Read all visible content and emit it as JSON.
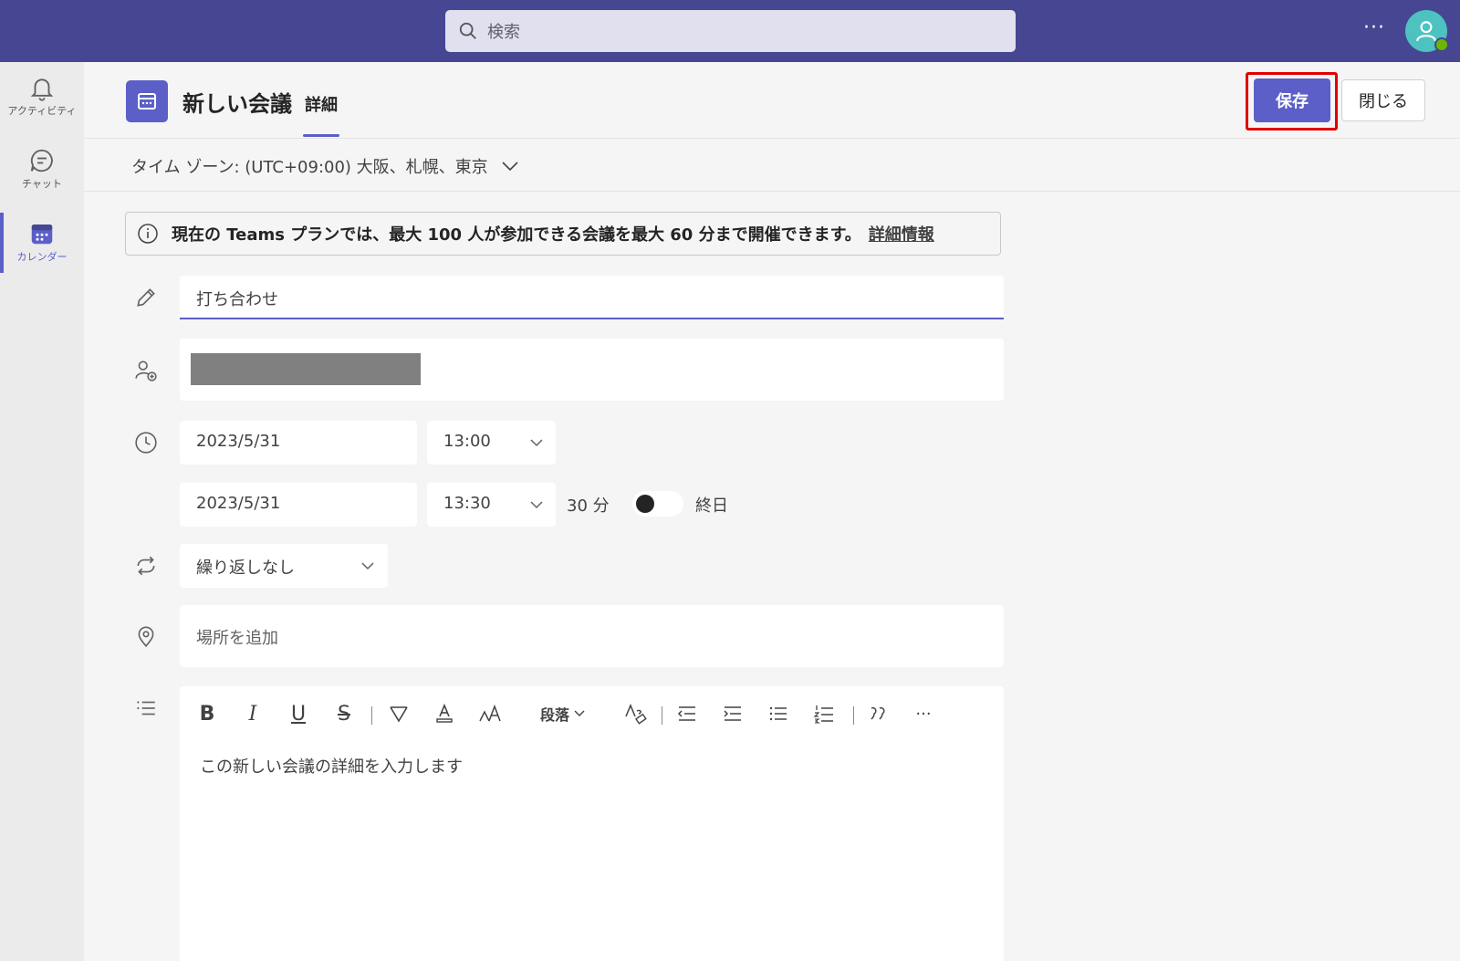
{
  "topbar": {
    "search_placeholder": "検索",
    "more": "···"
  },
  "rail": {
    "items": [
      {
        "label": "アクティビティ",
        "icon": "bell-icon"
      },
      {
        "label": "チャット",
        "icon": "chat-icon"
      },
      {
        "label": "カレンダー",
        "icon": "calendar-icon"
      }
    ]
  },
  "header": {
    "title": "新しい会議",
    "tab": "詳細",
    "save_label": "保存",
    "close_label": "閉じる"
  },
  "timezone": {
    "label": "タイム ゾーン: (UTC+09:00) 大阪、札幌、東京"
  },
  "banner": {
    "text": "現在の Teams プランでは、最大 100 人が参加できる会議を最大 60 分まで開催できます。",
    "link": "詳細情報"
  },
  "form": {
    "title_value": "打ち合わせ",
    "start_date": "2023/5/31",
    "start_time": "13:00",
    "end_date": "2023/5/31",
    "end_time": "13:30",
    "duration": "30 分",
    "all_day_label": "終日",
    "all_day": false,
    "repeat": "繰り返しなし",
    "location_placeholder": "場所を追加"
  },
  "editor": {
    "toolbar": {
      "bold": "B",
      "italic": "I",
      "underline": "U",
      "strike": "S",
      "paragraph": "段落",
      "more": "···"
    },
    "placeholder": "この新しい会議の詳細を入力します"
  },
  "colors": {
    "brand": "#464692",
    "accent": "#5b5fc7",
    "highlight": "#e00000"
  }
}
